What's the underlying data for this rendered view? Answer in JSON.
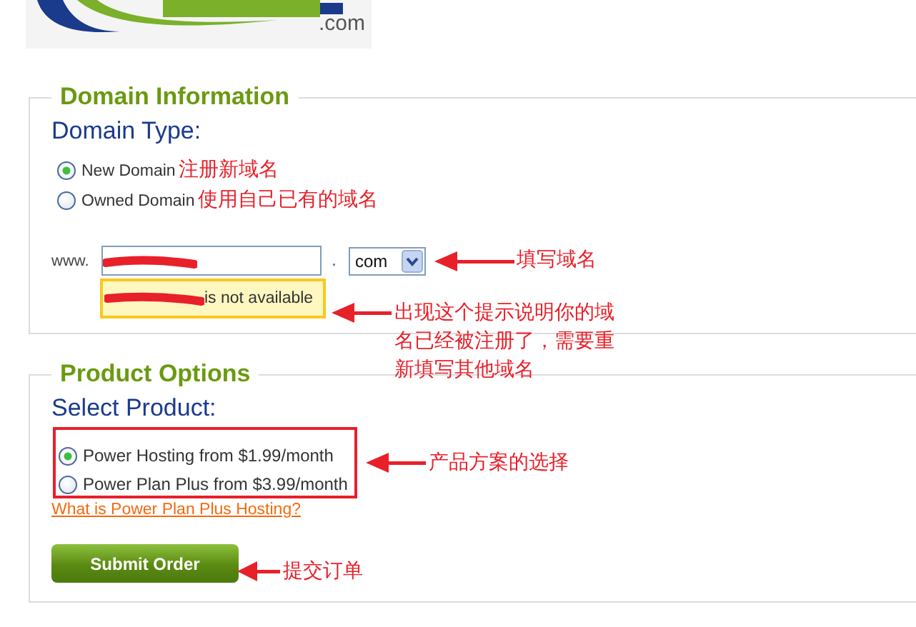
{
  "logo": {
    "text": ".com"
  },
  "domain_information": {
    "legend": "Domain Information",
    "heading": "Domain Type:",
    "options": [
      {
        "label": "New Domain",
        "selected": true,
        "note": "注册新域名"
      },
      {
        "label": "Owned Domain",
        "selected": false,
        "note": "使用自己已有的域名"
      }
    ],
    "prefix": "www.",
    "separator": ".",
    "tld": "com",
    "tld_note": "填写域名",
    "message": "is not available",
    "message_note": "出现这个提示说明你的域名已经被注册了，需要重新填写其他域名"
  },
  "product_options": {
    "legend": "Product Options",
    "heading": "Select Product:",
    "options": [
      {
        "label": "Power Hosting from $1.99/month",
        "selected": true
      },
      {
        "label": "Power Plan Plus from $3.99/month",
        "selected": false
      }
    ],
    "options_note": "产品方案的选择",
    "link": "What is Power Plan Plus Hosting?",
    "button": "Submit Order",
    "button_note": "提交订单"
  }
}
